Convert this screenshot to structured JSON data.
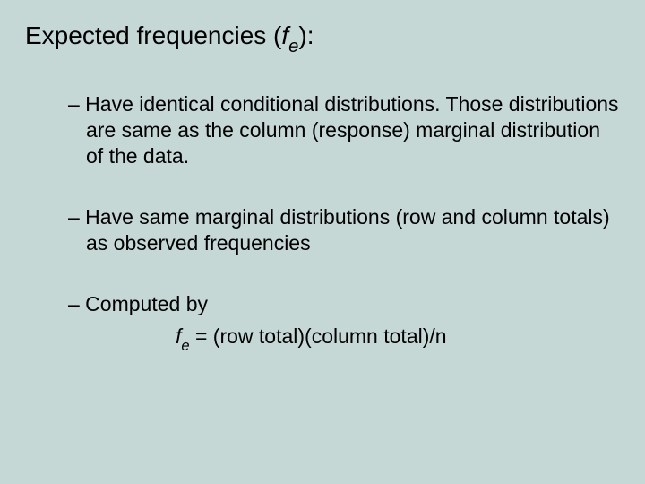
{
  "title": {
    "prefix": "Expected frequencies (",
    "var": "f",
    "sub": "e",
    "suffix": "):"
  },
  "bullets": {
    "b1": "– Have identical conditional distributions.  Those distributions are same as the column (response) marginal distribution of the data.",
    "b2": "– Have same marginal distributions (row and column totals) as observed frequencies",
    "b3": "– Computed by"
  },
  "formula": {
    "var": "f",
    "sub": "e",
    "eq": "  = (row total)(column total)/n"
  }
}
